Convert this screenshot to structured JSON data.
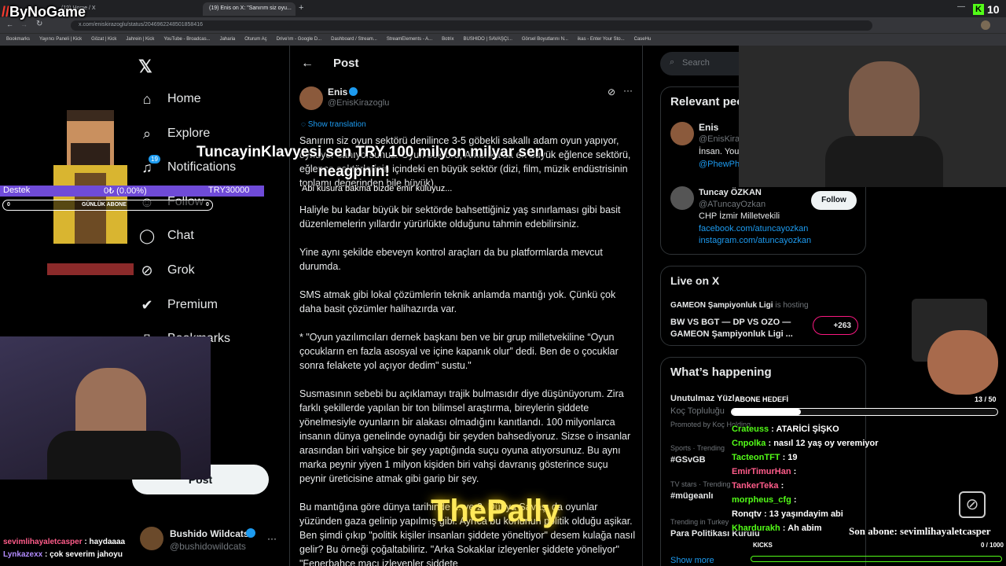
{
  "browser": {
    "tabs": [
      {
        "label": "(19) Home / X"
      },
      {
        "label": "(19) Enis on X: \"Sanırım siz oyu..."
      }
    ],
    "url": "x.com/eniskirazoglu/status/2046962248501858416",
    "bookmarks": [
      "Bookmarks",
      "Yayıncı Paneli | Kick",
      "Gözat | Kick",
      "Jahrein | Kick",
      "YouTube - Broadcas...",
      "Jaharia",
      "Oturum Aç",
      "Drive'ım - Google D...",
      "Dashboard / Stream...",
      "StreamElements - A...",
      "Botrix",
      "BUSHIDO | SAVAŞÇI...",
      "Görsel Boyutlarını N...",
      "ikas - Enter Your Sto...",
      "CaseHu"
    ]
  },
  "nav": {
    "items": [
      {
        "label": "Home",
        "icon": "home-icon"
      },
      {
        "label": "Explore",
        "icon": "search-icon"
      },
      {
        "label": "Notifications",
        "icon": "bell-icon",
        "badge": "19"
      },
      {
        "label": "Follow",
        "icon": "person-add-icon"
      },
      {
        "label": "Chat",
        "icon": "chat-icon"
      },
      {
        "label": "Grok",
        "icon": "grok-icon"
      },
      {
        "label": "Premium",
        "icon": "premium-icon"
      },
      {
        "label": "Bookmarks",
        "icon": "bookmark-icon"
      }
    ],
    "post_button": "Post",
    "account": {
      "name": "Bushido Wildcats",
      "handle": "@bushidowildcats"
    }
  },
  "post": {
    "header": "Post",
    "author": {
      "name": "Enis",
      "handle": "@EnisKirazoglu"
    },
    "show_translation": "Show translation",
    "paragraphs": [
      "Sanırım siz oyun sektörü denilince 3-5 göbekli sakallı adam oyun yapıyor, oynuyor sanıyorsunuz. Oyun sektörü, Amerika'da en büyük eğlence sektörü, eğlence sektörlerinin içindeki en büyük sektör (dizi, film, müzik endüstrisinin toplamı değerinden bile büyük).",
      "Haliyle bu kadar büyük bir sektörde bahsettiğiniz yaş sınırlaması gibi basit düzenlemelerin yıllardır yürürlükte olduğunu tahmin edebilirsiniz.",
      "Yine aynı şekilde ebeveyn kontrol araçları da bu platformlarda mevcut durumda.",
      "SMS atmak gibi lokal çözümlerin teknik anlamda mantığı yok. Çünkü çok daha basit çözümler halihazırda var.",
      "* \"Oyun yazılımcıları dernek başkanı ben ve bir grup milletvekiline “Oyun çocukların en fazla asosyal ve içine kapanık olur” dedi. Ben de o çocuklar sonra felakete yol açıyor dedim\" sustu.\"",
      " Susmasının sebebi bu açıklamayı trajik bulmasıdır diye düşünüyorum. Zira farklı şekillerde yapılan bir ton bilimsel araştırma, bireylerin şiddete yönelmesiyle oyunların bir alakası olmadığını kanıtlandı. 100 milyonlarca insanın dünya genelinde oynadığı bir şeyden bahsediyoruz. Sizse o insanlar arasından biri vahşice bir şey yaptığında suçu oyuna atıyorsunuz. Bu aynı marka peynir yiyen 1 milyon kişiden biri vahşi davranış gösterince suçu peynir üreticisine atmak gibi garip bir şey.",
      "Bu mantığına göre dünya tarihinde 1. ve 2. Dünya Savaşı da oyunlar yüzünden gaza gelinip yapılmış gibi. Ayrıca bu konunun politik olduğu aşikar. Ben şimdi çıkıp \"politik kişiler insanları şiddete yöneltiyor\" desem kulağa nasıl gelir? Bu örneği çoğaltabiliriz. \"Arka Sokaklar izleyenler şiddete yöneliyor\" \"Fenerbahçe maçı izleyenler şiddete"
    ]
  },
  "right": {
    "search_placeholder": "Search",
    "relevant_title": "Relevant people",
    "people": [
      {
        "name": "Enis",
        "handle": "@EnisKirazoglu",
        "bio": "İnsan. You",
        "bio2": "@PhewPh"
      },
      {
        "name": "Tuncay ÖZKAN",
        "handle": "@ATuncayOzkan",
        "bio": "CHP İzmir Milletvekili",
        "link1": "facebook.com/atuncayozkan",
        "link2": "instagram.com/atuncayozkan",
        "follow": "Follow"
      }
    ],
    "live_title": "Live on X",
    "live": {
      "host": "GAMEON Şampiyonluk Ligi",
      "status": "is hosting",
      "line1": "BW VS BGT — DP VS OZO —",
      "line2": "GAMEON Şampiyonluk Ligi ...",
      "count": "+263"
    },
    "happening_title": "What’s happening",
    "trends": [
      {
        "meta": "",
        "title": "Unutulmaz Yüzler",
        "sub": "Koç Topluluğu",
        "promo": "Promoted by Koç Holding"
      },
      {
        "meta": "Sports · Trending",
        "title": "#GSvGB"
      },
      {
        "meta": "TV stars · Trending",
        "title": "#mügeanlı"
      },
      {
        "meta": "Trending in Turkey",
        "title": "Para Politikası Kurulu"
      }
    ],
    "show_more": "Show more"
  },
  "overlay": {
    "logo": "ByNoGame",
    "kick_count": "10",
    "donation_line1": "TuncayinKlavyesi sen TRY 100 milyon milyar sen",
    "donation_line2": "neagpnin!",
    "donation_line3": "Abi kusura bakma bizde emir kuluyuz...",
    "goal_label": "Destek",
    "goal_value": "0₺ (0.00%)",
    "goal_target": "TRY30000",
    "sub_bar_left": "0",
    "sub_bar_label": "GÜNLÜK ABONE",
    "sub_bar_right": "0",
    "sub_goal_label": "ABONE HEDEFİ",
    "sub_goal_count": "13 / 50",
    "kicks_label": "KICKS",
    "kicks_count": "0 / 1000",
    "last_sub": "Son abone: sevimlihayaletcasper",
    "brand": "ThePally",
    "chat": [
      {
        "user": "Crateuss",
        "msg": "ATARİCİ ŞİŞKO",
        "color": "#53fc18"
      },
      {
        "user": "Cnpolka",
        "msg": "nasıl 12 yaş oy veremiyor",
        "color": "#53fc18"
      },
      {
        "user": "TacteonTFT",
        "msg": "19",
        "color": "#53fc18"
      },
      {
        "user": "EmirTimurHan",
        "msg": "",
        "color": "#ff5c8a"
      },
      {
        "user": "TankerTeka",
        "msg": "",
        "color": "#ff5c8a"
      },
      {
        "user": "morpheus_cfg",
        "msg": "",
        "color": "#53fc18"
      },
      {
        "user": "Ronqtv",
        "msg": "13 yaşındayim abi",
        "color": "#ffffff"
      },
      {
        "user": "Khardurakh",
        "msg": "Ah abim",
        "color": "#53fc18"
      }
    ],
    "left_chat": [
      {
        "user": "sevimlihayaletcasper",
        "msg": "haydaaaa",
        "color": "#ff5c8a"
      },
      {
        "user": "Lynkazexx",
        "msg": "çok severim jahoyu",
        "color": "#b38cff"
      }
    ]
  }
}
